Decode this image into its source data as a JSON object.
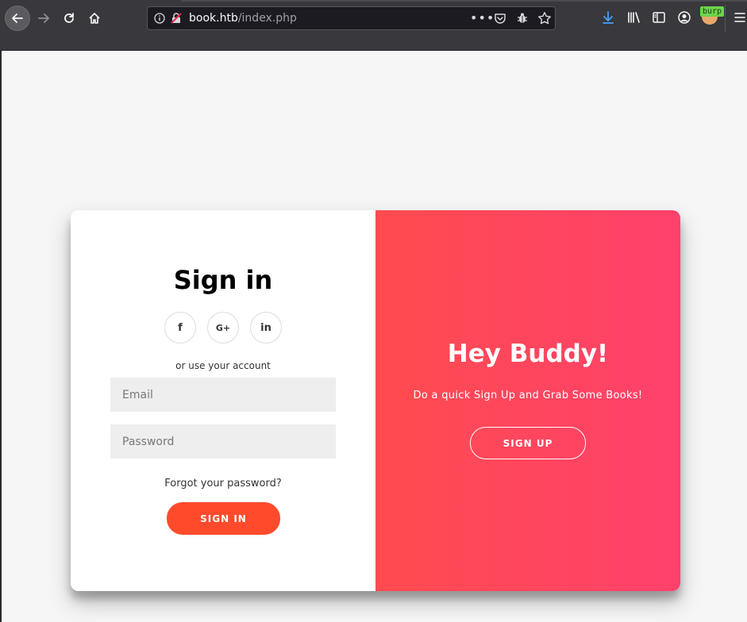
{
  "browser": {
    "url_host": "book.htb",
    "url_path": "/index.php",
    "url_more": "•••",
    "burp_badge": "burp"
  },
  "signin": {
    "title": "Sign in",
    "social": [
      {
        "name": "facebook",
        "glyph": "f"
      },
      {
        "name": "google-plus",
        "glyph": "G+"
      },
      {
        "name": "linkedin",
        "glyph": "in"
      }
    ],
    "alt_text": "or use your account",
    "email_placeholder": "Email",
    "password_placeholder": "Password",
    "forgot": "Forgot your password?",
    "button": "SIGN IN"
  },
  "overlay": {
    "title": "Hey Buddy!",
    "text": "Do a quick Sign Up and Grab Some Books!",
    "button": "SIGN UP"
  },
  "colors": {
    "accent": "#ff4b2b",
    "gradient_start": "#ff4b4f",
    "gradient_end": "#ff416c"
  }
}
